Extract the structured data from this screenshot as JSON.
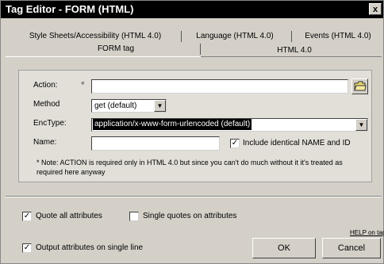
{
  "window": {
    "title": "Tag Editor - FORM    (HTML)",
    "close_glyph": "x"
  },
  "tabs": {
    "row1": [
      "Style Sheets/Accessibility (HTML 4.0)",
      "Language (HTML 4.0)",
      "Events (HTML 4.0)"
    ],
    "row2": [
      "FORM tag",
      "HTML 4.0"
    ]
  },
  "form": {
    "action_label": "Action:",
    "action_required_mark": "*",
    "action_value": "",
    "method_label": "Method",
    "method_value": "get (default)",
    "enctype_label": "EncType:",
    "enctype_value": "application/x-www-form-urlencoded (default)",
    "name_label": "Name:",
    "name_value": "",
    "include_label": "Include identical NAME and ID",
    "include_checked": "✓",
    "note": "* Note: ACTION is required only in HTML 4.0 but since you can't do much without it it's treated as required here anyway"
  },
  "options": {
    "quote_all_label": "Quote all attributes",
    "quote_all_checked": "✓",
    "single_quotes_label": "Single quotes on attributes",
    "single_quotes_checked": "",
    "output_single_line_label": "Output attributes on single line",
    "output_single_line_checked": "✓"
  },
  "footer": {
    "help_link": "HELP on tag",
    "ok_label": "OK",
    "cancel_label": "Cancel"
  },
  "icons": {
    "folder": "folder-icon",
    "dropdown": "▼"
  }
}
